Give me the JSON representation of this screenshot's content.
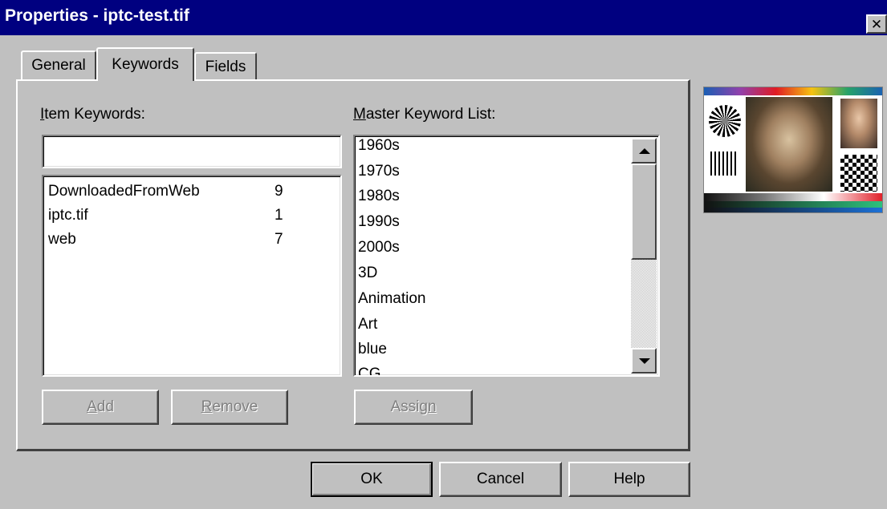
{
  "window": {
    "title": "Properties - iptc-test.tif",
    "close_glyph": "✕"
  },
  "tabs": [
    {
      "label": "General",
      "active": false
    },
    {
      "label": "Keywords",
      "active": true
    },
    {
      "label": "Fields",
      "active": false
    }
  ],
  "item_keywords": {
    "label_mnemonic": "I",
    "label_rest": "tem Keywords:",
    "input_value": "",
    "rows": [
      {
        "name": "DownloadedFromWeb",
        "count": "9"
      },
      {
        "name": "iptc.tif",
        "count": "1"
      },
      {
        "name": "web",
        "count": "7"
      }
    ]
  },
  "master_keywords": {
    "label_mnemonic": "M",
    "label_rest": "aster Keyword List:",
    "items": [
      "1960s",
      "1970s",
      "1980s",
      "1990s",
      "2000s",
      "3D",
      "Animation",
      "Art",
      "blue",
      "CG"
    ]
  },
  "buttons": {
    "add": {
      "mnemonic": "A",
      "rest": "dd",
      "enabled": false
    },
    "remove": {
      "mnemonic": "R",
      "rest": "emove",
      "enabled": false
    },
    "assign": {
      "pre": "Assig",
      "mnemonic": "n",
      "enabled": false
    },
    "ok": "OK",
    "cancel": "Cancel",
    "help": "Help"
  },
  "icons": {
    "close": "close-icon",
    "scroll_up": "arrow-up-icon",
    "scroll_down": "arrow-down-icon"
  },
  "colors": {
    "title_bar": "#000080",
    "face": "#c0c0c0",
    "disabled_text": "#808080"
  }
}
